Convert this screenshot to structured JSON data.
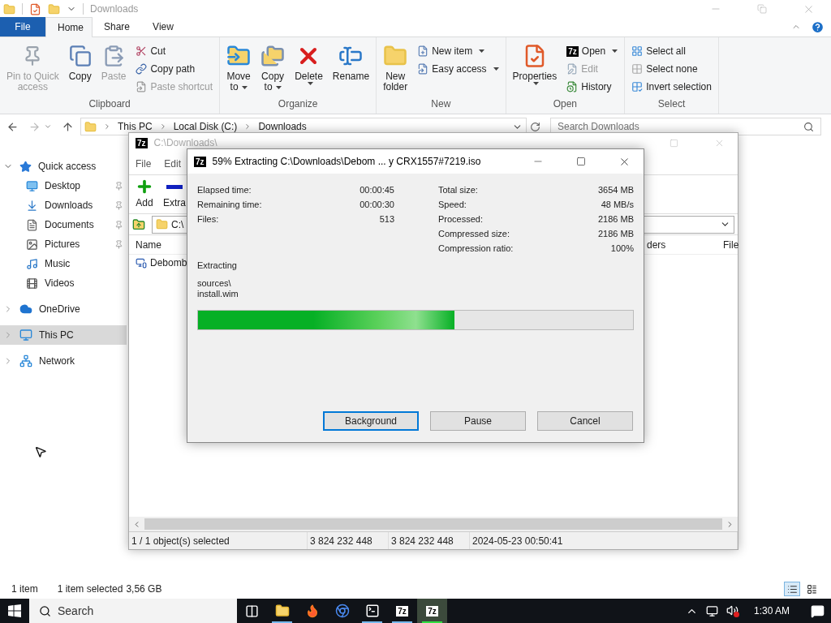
{
  "explorer": {
    "title": "Downloads",
    "tabs": [
      {
        "label": "File",
        "kind": "file",
        "selected": false
      },
      {
        "label": "Home",
        "kind": "tab",
        "selected": true
      },
      {
        "label": "Share",
        "kind": "tab",
        "selected": false
      },
      {
        "label": "View",
        "kind": "tab",
        "selected": false
      }
    ],
    "ribbon_groups": [
      {
        "name": "Clipboard",
        "items": [
          {
            "kind": "large",
            "lines": [
              "Pin to Quick",
              "access"
            ],
            "disabled": true,
            "dropdown": false
          },
          {
            "kind": "large",
            "lines": [
              "Copy"
            ],
            "disabled": false,
            "dropdown": false
          },
          {
            "kind": "large",
            "lines": [
              "Paste"
            ],
            "disabled": true,
            "dropdown": false
          },
          {
            "kind": "small",
            "lines": [
              "Cut"
            ],
            "disabled": false,
            "dropdown": false
          },
          {
            "kind": "small",
            "lines": [
              "Copy path"
            ],
            "disabled": false,
            "dropdown": false
          },
          {
            "kind": "small",
            "lines": [
              "Paste shortcut"
            ],
            "disabled": true,
            "dropdown": false
          }
        ]
      },
      {
        "name": "Organize",
        "items": [
          {
            "kind": "large",
            "lines": [
              "Move",
              "to"
            ],
            "disabled": false,
            "dropdown": true
          },
          {
            "kind": "large",
            "lines": [
              "Copy",
              "to"
            ],
            "disabled": false,
            "dropdown": true
          },
          {
            "kind": "large",
            "lines": [
              "Delete"
            ],
            "disabled": false,
            "dropdown": true
          },
          {
            "kind": "large",
            "lines": [
              "Rename"
            ],
            "disabled": false,
            "dropdown": false
          }
        ]
      },
      {
        "name": "New",
        "items": [
          {
            "kind": "large",
            "lines": [
              "New",
              "folder"
            ],
            "disabled": false,
            "dropdown": false
          },
          {
            "kind": "small",
            "lines": [
              "New item"
            ],
            "disabled": false,
            "dropdown": true
          },
          {
            "kind": "small",
            "lines": [
              "Easy access"
            ],
            "disabled": false,
            "dropdown": true
          }
        ]
      },
      {
        "name": "Open",
        "items": [
          {
            "kind": "large",
            "lines": [
              "Properties"
            ],
            "disabled": false,
            "dropdown": true
          },
          {
            "kind": "small",
            "lines": [
              "Open"
            ],
            "disabled": false,
            "dropdown": true,
            "logo": "7z"
          },
          {
            "kind": "small",
            "lines": [
              "Edit"
            ],
            "disabled": true,
            "dropdown": false
          },
          {
            "kind": "small",
            "lines": [
              "History"
            ],
            "disabled": false,
            "dropdown": false
          }
        ]
      },
      {
        "name": "Select",
        "items": [
          {
            "kind": "small",
            "lines": [
              "Select all"
            ],
            "disabled": false,
            "dropdown": false
          },
          {
            "kind": "small",
            "lines": [
              "Select none"
            ],
            "disabled": false,
            "dropdown": false
          },
          {
            "kind": "small",
            "lines": [
              "Invert selection"
            ],
            "disabled": false,
            "dropdown": false
          }
        ]
      }
    ],
    "breadcrumbs": [
      "This PC",
      "Local Disk (C:)",
      "Downloads"
    ],
    "search": {
      "placeholder": "Search Downloads"
    },
    "nav": [
      {
        "label": "Quick access",
        "expanded": true,
        "selected": false,
        "children": [
          {
            "label": "Desktop",
            "pinned": true
          },
          {
            "label": "Downloads",
            "pinned": true
          },
          {
            "label": "Documents",
            "pinned": true
          },
          {
            "label": "Pictures",
            "pinned": true
          },
          {
            "label": "Music",
            "pinned": false
          },
          {
            "label": "Videos",
            "pinned": false
          }
        ]
      },
      {
        "label": "OneDrive",
        "expanded": false,
        "selected": false
      },
      {
        "label": "This PC",
        "expanded": false,
        "selected": true
      },
      {
        "label": "Network",
        "expanded": false,
        "selected": false
      }
    ],
    "status": {
      "count": "1 item",
      "selection": "1 item selected",
      "size": "3,56 GB"
    },
    "views": [
      {
        "kind": "details",
        "selected": true
      },
      {
        "kind": "large",
        "selected": false
      }
    ]
  },
  "sevenzip": {
    "logo": "7z",
    "title": "C:\\Downloads\\",
    "menu": [
      "File",
      "Edit"
    ],
    "toolbar": [
      "Add",
      "Extra"
    ],
    "path": "C:\\",
    "columns": [
      "Name",
      "ders",
      "File"
    ],
    "rows": [
      {
        "name": "Debomb"
      }
    ],
    "status": [
      "1 / 1 object(s) selected",
      "3 824 232 448",
      "3 824 232 448",
      "2024-05-23 00:50:41"
    ]
  },
  "dialog": {
    "logo": "7z",
    "title": "59% Extracting C:\\Downloads\\Debom ... y CRX1557#7219.iso",
    "left_stats": [
      {
        "label": "Elapsed time:",
        "value": "00:00:45"
      },
      {
        "label": "Remaining time:",
        "value": "00:00:30"
      },
      {
        "label": "Files:",
        "value": "513"
      }
    ],
    "right_stats": [
      {
        "label": "Total size:",
        "value": "3654 MB"
      },
      {
        "label": "Speed:",
        "value": "48 MB/s"
      },
      {
        "label": "Processed:",
        "value": "2186 MB"
      },
      {
        "label": "Compressed size:",
        "value": "2186 MB"
      },
      {
        "label": "Compression ratio:",
        "value": "100%"
      }
    ],
    "action": "Extracting",
    "file_lines": [
      "sources\\",
      "install.wim"
    ],
    "progress": {
      "level": 0.59
    },
    "buttons": [
      {
        "label": "Background",
        "selected": true
      },
      {
        "label": "Pause",
        "selected": false
      },
      {
        "label": "Cancel",
        "selected": false
      }
    ]
  },
  "taskbar": {
    "search": "Search",
    "apps": [
      {
        "kind": "taskview",
        "running": false,
        "selected": false
      },
      {
        "kind": "explorer",
        "running": true,
        "selected": false
      },
      {
        "kind": "firefox",
        "running": false,
        "selected": false
      },
      {
        "kind": "chrome",
        "running": false,
        "selected": false
      },
      {
        "kind": "cmd",
        "running": true,
        "selected": false
      },
      {
        "kind": "sevenzip",
        "logo": "7z",
        "running": true,
        "selected": false
      },
      {
        "kind": "sevenzip",
        "logo": "7z",
        "running": true,
        "selected": true
      }
    ],
    "time": "1:30 AM"
  }
}
